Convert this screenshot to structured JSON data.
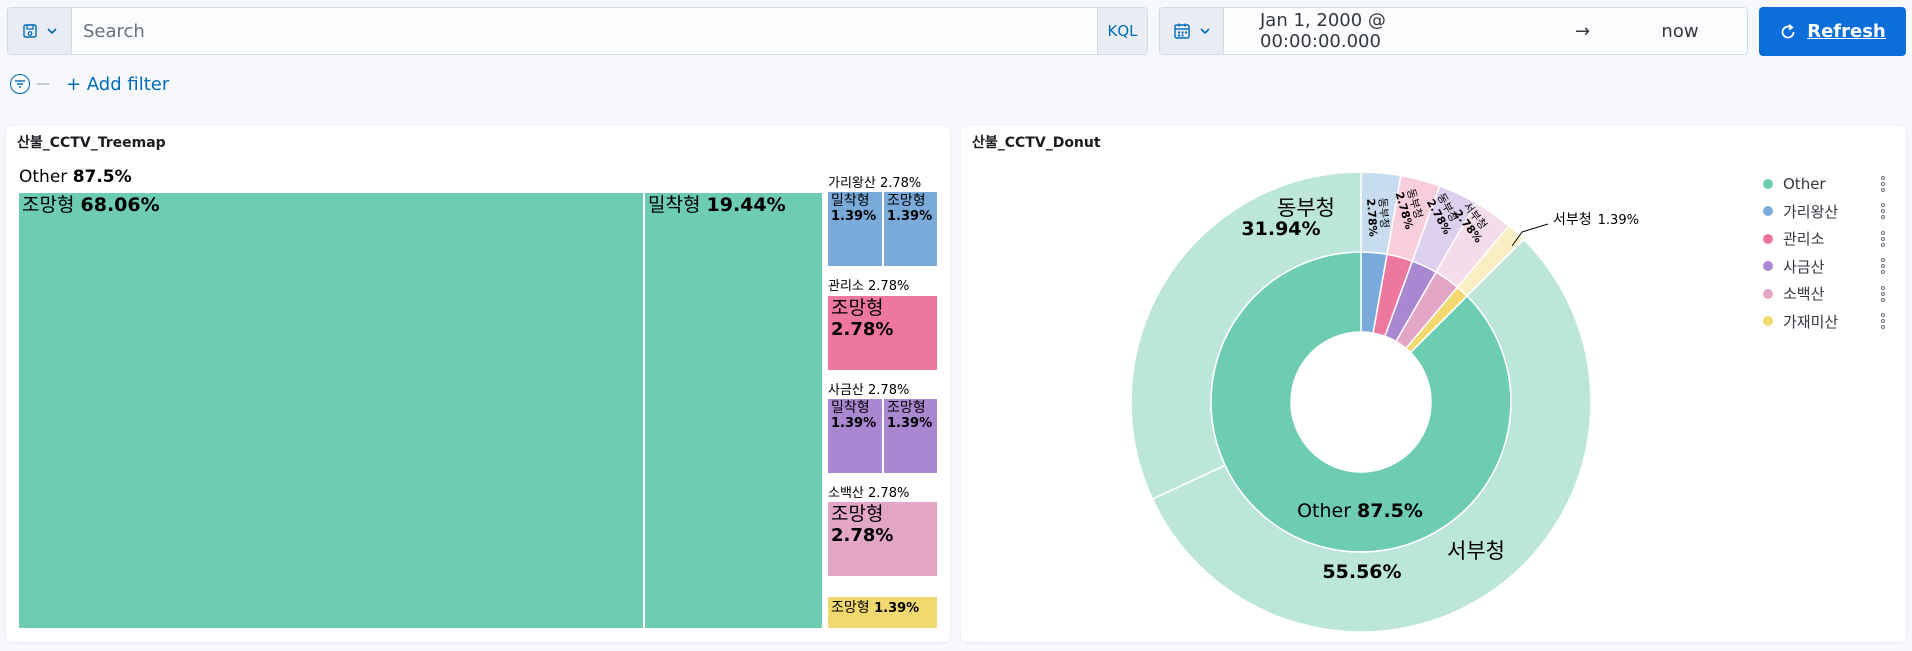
{
  "query": {
    "placeholder": "Search",
    "language": "KQL",
    "value": ""
  },
  "time": {
    "start": "Jan 1, 2000 @ 00:00:00.000",
    "arrow": "→",
    "end": "now"
  },
  "refresh_label": "Refresh",
  "add_filter_label": "+ Add filter",
  "filter_dash": "—",
  "treemap": {
    "title": "산불_CCTV_Treemap",
    "other_name": "Other",
    "other_pct": "87.5%",
    "cells": {
      "other_jomang": {
        "name": "조망형",
        "pct": "68.06%"
      },
      "other_milchak": {
        "name": "밀착형",
        "pct": "19.44%"
      },
      "gariwang": {
        "group": "가리왕산",
        "group_pct": "2.78%",
        "a_name": "밀착형",
        "a_pct": "1.39%",
        "b_name": "조망형",
        "b_pct": "1.39%"
      },
      "gwanriso": {
        "group": "관리소",
        "group_pct": "2.78%",
        "name": "조망형",
        "pct": "2.78%"
      },
      "sageum": {
        "group": "사금산",
        "group_pct": "2.78%",
        "a_name": "밀착형",
        "a_pct": "1.39%",
        "b_name": "조망형",
        "b_pct": "1.39%"
      },
      "sobaek": {
        "group": "소백산",
        "group_pct": "2.78%",
        "name": "조망형",
        "pct": "2.78%"
      },
      "gajae": {
        "name": "조망형",
        "pct": "1.39%"
      }
    }
  },
  "donut": {
    "title": "산불_CCTV_Donut",
    "inner_label_name": "Other",
    "inner_label_pct": "87.5%",
    "outer_labels": {
      "dongbu": {
        "name": "동부청",
        "pct": "31.94%"
      },
      "seobu": {
        "name": "서부청",
        "pct": "55.56%"
      },
      "seobu_small": {
        "name": "서부청",
        "pct": "1.39%"
      },
      "small1": {
        "name": "동부청",
        "pct": "2.78%"
      },
      "small2": {
        "name": "동부청",
        "pct": "2.78%"
      },
      "small3": {
        "name": "동부청",
        "pct": "2.78%"
      },
      "small4": {
        "name": "서부청",
        "pct": "2.78%"
      }
    },
    "legend": [
      {
        "label": "Other",
        "color": "#6dccb1"
      },
      {
        "label": "가리왕산",
        "color": "#79aad9"
      },
      {
        "label": "관리소",
        "color": "#ee789d"
      },
      {
        "label": "사금산",
        "color": "#a987d1"
      },
      {
        "label": "소백산",
        "color": "#e4a6c7"
      },
      {
        "label": "가재미산",
        "color": "#f1d86f"
      }
    ]
  },
  "colors": {
    "accent": "#0b6ed9",
    "other": "#6dccb1",
    "other_light": "#bce6d9",
    "gariwang": "#79aad9",
    "gwanriso": "#ee789d",
    "sageum": "#a987d1",
    "sobaek": "#e4a6c7",
    "gajae": "#f1d86f"
  },
  "chart_data": {
    "type": "pie",
    "title": "산불_CCTV_Donut",
    "inner": [
      {
        "name": "Other",
        "value": 87.5
      },
      {
        "name": "가리왕산",
        "value": 2.78
      },
      {
        "name": "관리소",
        "value": 2.78
      },
      {
        "name": "사금산",
        "value": 2.78
      },
      {
        "name": "소백산",
        "value": 2.78
      },
      {
        "name": "가재미산",
        "value": 1.39
      }
    ],
    "outer": [
      {
        "parent": "Other",
        "name": "서부청",
        "value": 55.56
      },
      {
        "parent": "Other",
        "name": "동부청",
        "value": 31.94
      },
      {
        "parent": "가리왕산",
        "name": "동부청",
        "value": 2.78
      },
      {
        "parent": "관리소",
        "name": "동부청",
        "value": 2.78
      },
      {
        "parent": "사금산",
        "name": "동부청",
        "value": 2.78
      },
      {
        "parent": "소백산",
        "name": "서부청",
        "value": 2.78
      },
      {
        "parent": "가재미산",
        "name": "서부청",
        "value": 1.39
      }
    ],
    "legend_position": "top-right"
  }
}
